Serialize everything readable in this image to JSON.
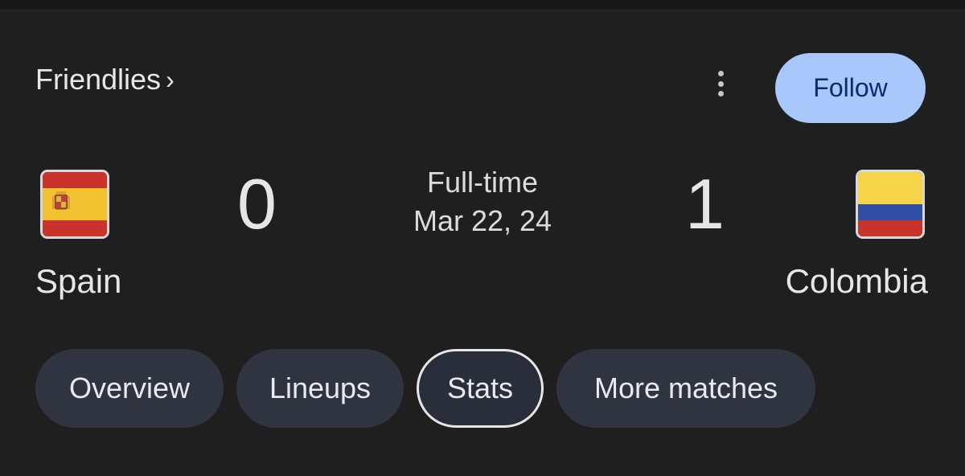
{
  "header": {
    "league_label": "Friendlies",
    "league_chevron": "›",
    "more_icon": "more-vert-icon",
    "follow_label": "Follow"
  },
  "match": {
    "home": {
      "name": "Spain",
      "score": "0",
      "flag_icon": "spain-flag-icon"
    },
    "away": {
      "name": "Colombia",
      "score": "1",
      "flag_icon": "colombia-flag-icon"
    },
    "status": "Full-time",
    "date": "Mar 22, 24"
  },
  "tabs": [
    {
      "label": "Overview",
      "selected": false
    },
    {
      "label": "Lineups",
      "selected": false
    },
    {
      "label": "Stats",
      "selected": true
    },
    {
      "label": "More matches",
      "selected": false
    }
  ],
  "colors": {
    "background": "#1f1f1f",
    "follow_bg": "#a8c7fa",
    "tab_bg": "#303441",
    "selected_border": "#e6e6e6"
  }
}
